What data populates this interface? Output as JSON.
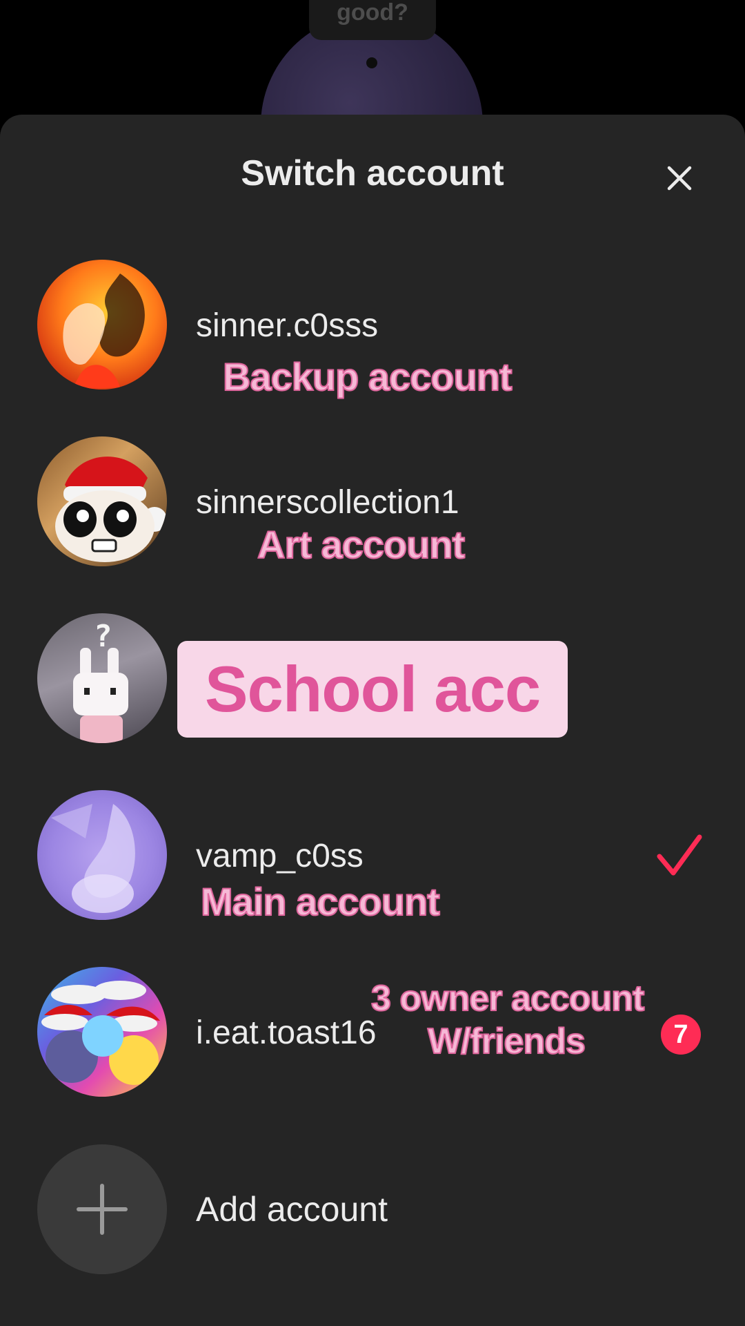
{
  "background": {
    "bubble_text": "good?"
  },
  "sheet": {
    "title": "Switch account",
    "close_icon": "close-icon"
  },
  "accounts": [
    {
      "username": "sinner.c0sss",
      "note": "Backup account",
      "avatar_icon": "avatar-fire-art"
    },
    {
      "username": "sinnerscollection1",
      "note": "Art account",
      "avatar_icon": "avatar-santa-hat-character"
    },
    {
      "username": "",
      "note": "School acc",
      "avatar_icon": "avatar-bunny-question"
    },
    {
      "username": "vamp_c0ss",
      "note": "Main account",
      "avatar_icon": "avatar-purple-cat",
      "selected": true
    },
    {
      "username": "i.eat.toast16",
      "note_line1": "3 owner account",
      "note_line2": "W/friends",
      "badge": "7",
      "avatar_icon": "avatar-group-santa"
    }
  ],
  "add_account": {
    "label": "Add account"
  },
  "colors": {
    "sheet_bg": "#252525",
    "accent_red": "#fe2c55",
    "sticker_pink": "#f6b9d6",
    "sticker_stroke": "#e0679e",
    "school_bg": "#f8d7e8",
    "school_text": "#e0559a"
  }
}
